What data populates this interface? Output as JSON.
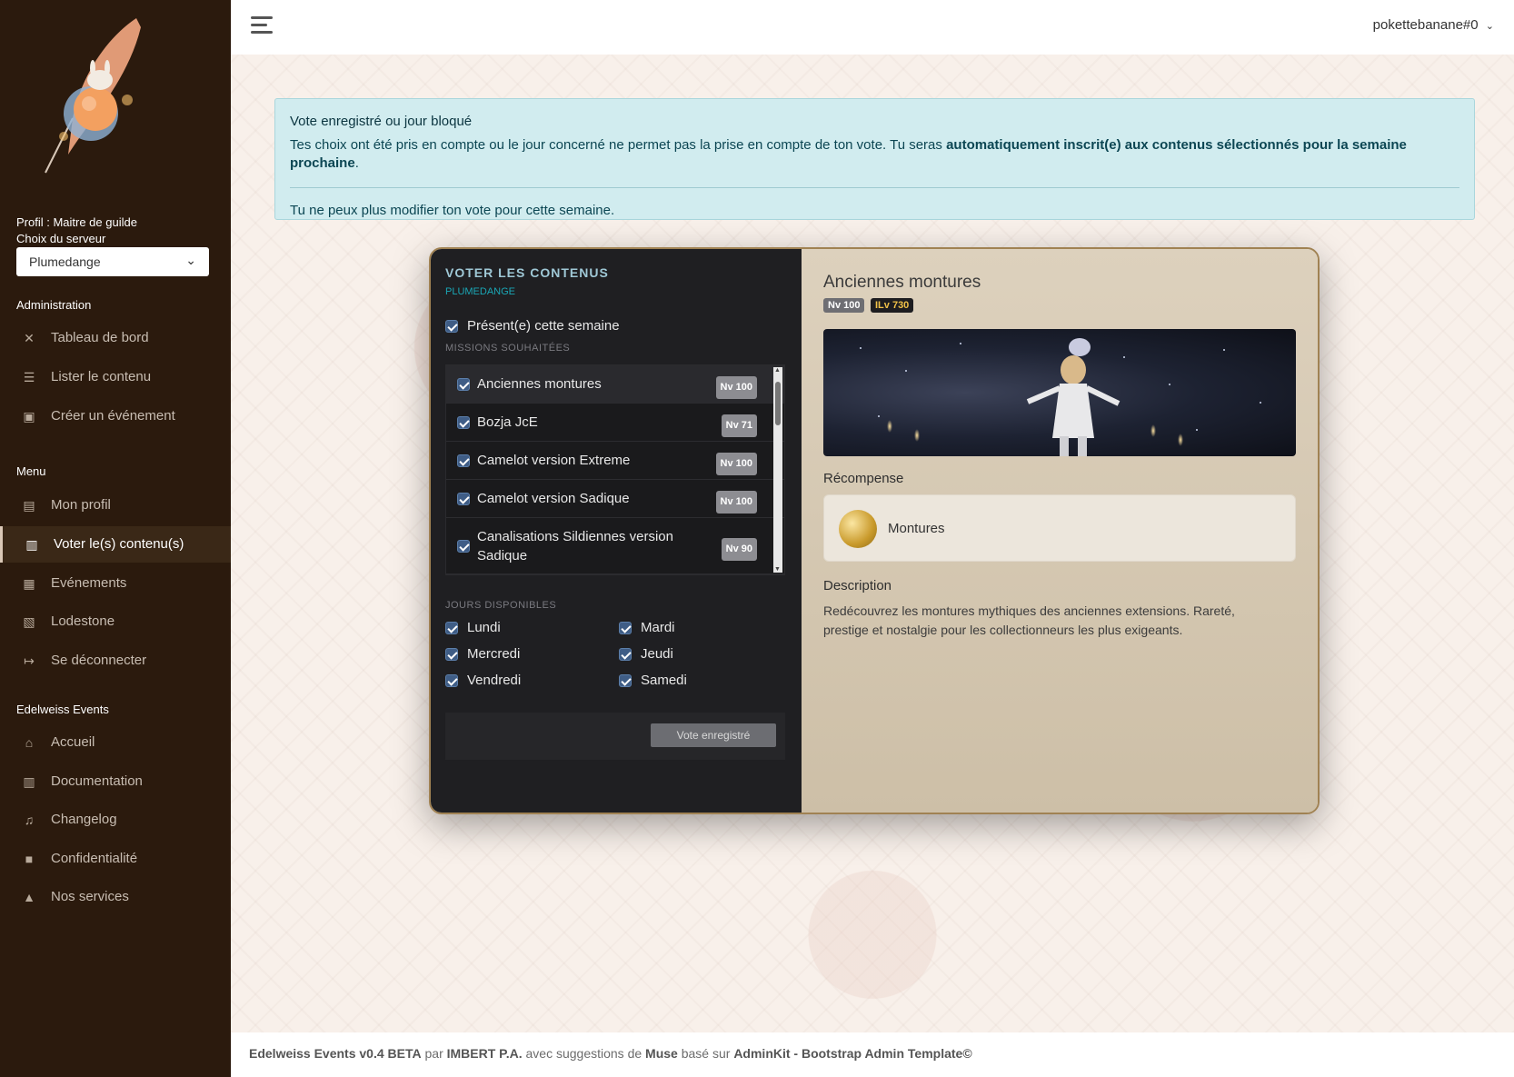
{
  "sidebar": {
    "profile_line": "Profil : Maitre de guilde",
    "server_label": "Choix du serveur",
    "server_value": "Plumedange",
    "sections": {
      "admin": "Administration",
      "menu": "Menu",
      "edelweiss": "Edelweiss Events"
    },
    "admin_items": [
      {
        "label": "Tableau de bord",
        "icon": "tools-icon"
      },
      {
        "label": "Lister le contenu",
        "icon": "list-icon"
      },
      {
        "label": "Créer un événement",
        "icon": "calendar-plus-icon"
      }
    ],
    "menu_items": [
      {
        "label": "Mon profil",
        "icon": "profile-icon"
      },
      {
        "label": "Voter le(s) contenu(s)",
        "icon": "vote-icon",
        "active": true
      },
      {
        "label": "Evénements",
        "icon": "calendar-icon"
      },
      {
        "label": "Lodestone",
        "icon": "book-icon"
      },
      {
        "label": "Se déconnecter",
        "icon": "logout-icon"
      }
    ],
    "edelweiss_items": [
      {
        "label": "Accueil",
        "icon": "home-icon"
      },
      {
        "label": "Documentation",
        "icon": "doc-icon"
      },
      {
        "label": "Changelog",
        "icon": "music-icon"
      },
      {
        "label": "Confidentialité",
        "icon": "lock-icon"
      },
      {
        "label": "Nos services",
        "icon": "service-icon"
      }
    ]
  },
  "topbar": {
    "user": "pokettebanane#0"
  },
  "alert": {
    "title": "Vote enregistré ou jour bloqué",
    "body_start": "Tes choix ont été pris en compte ou le jour concerné ne permet pas la prise en compte de ton vote. Tu seras ",
    "body_bold": "automatiquement inscrit(e) aux contenus sélectionnés pour la semaine prochaine",
    "body_end": ".",
    "note": "Tu ne peux plus modifier ton vote pour cette semaine."
  },
  "vote": {
    "title": "VOTER LES CONTENUS",
    "subtitle": "PLUMEDANGE",
    "present_label": "Présent(e) cette semaine",
    "missions_header": "MISSIONS SOUHAITÉES",
    "missions": [
      {
        "name": "Anciennes montures",
        "level": "Nv 100"
      },
      {
        "name": "Bozja JcE",
        "level": "Nv 71"
      },
      {
        "name": "Camelot version Extreme",
        "level": "Nv 100"
      },
      {
        "name": "Camelot version Sadique",
        "level": "Nv 100"
      },
      {
        "name": "Canalisations Sildiennes version Sadique",
        "level": "Nv 90"
      }
    ],
    "days_header": "JOURS DISPONIBLES",
    "days": [
      "Lundi",
      "Mardi",
      "Mercredi",
      "Jeudi",
      "Vendredi",
      "Samedi"
    ],
    "button": "Vote enregistré"
  },
  "detail": {
    "title": "Anciennes montures",
    "level": "Nv 100",
    "ilvl": "ILv 730",
    "reward_label": "Récompense",
    "reward": "Montures",
    "desc_label": "Description",
    "desc": "Redécouvrez les montures mythiques des anciennes extensions. Rareté, prestige et nostalgie pour les collectionneurs les plus exigeants."
  },
  "footer": {
    "app": "Edelweiss Events v0.4 BETA",
    "par": " par ",
    "author": "IMBERT P.A.",
    "avec": " avec suggestions de ",
    "muse": "Muse",
    "base": " basé sur ",
    "template": "AdminKit - Bootstrap Admin Template©"
  }
}
